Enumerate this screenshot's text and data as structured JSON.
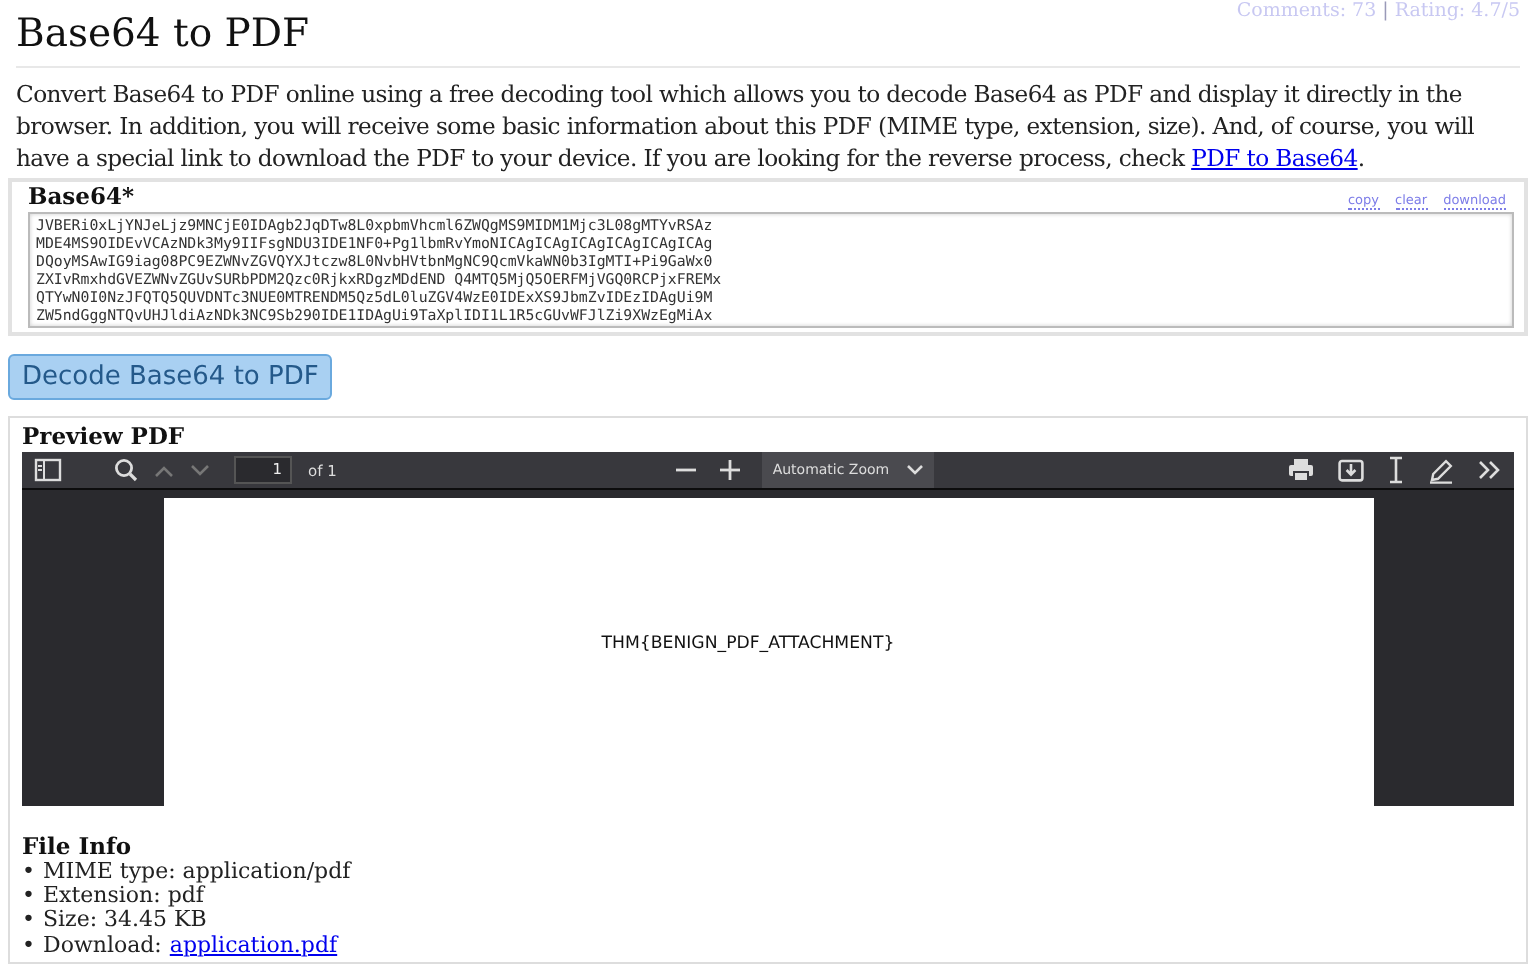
{
  "header": {
    "title": "Base64 to PDF",
    "comments": "Comments: 73",
    "separator": "|",
    "rating": "Rating: 4.7/5"
  },
  "intro": {
    "text": "Convert Base64 to PDF online using a free decoding tool which allows you to decode Base64 as PDF and display it directly in the browser. In addition, you will receive some basic information about this PDF (MIME type, extension, size). And, of course, you will have a special link to download the PDF to your device. If you are looking for the reverse process, check ",
    "link": "PDF to Base64",
    "end": "."
  },
  "input": {
    "label": "Base64*",
    "actions": [
      "copy",
      "clear",
      "download"
    ],
    "lines": [
      "JVBERi0xLjYNJeLjz9MNCjE0IDAgb2JqDTw8L0xpbmVhcml6ZWQgMS9MIDM1Mjc3L08gMTYvRSAz",
      "MDE4MS9OIDEvVCAzNDk3My9IIFsgNDU3IDE1NF0+Pg1lbmRvYmoNICAgICAgICAgICAgICAgICAg",
      "DQoyMSAwIG9iag08PC9EZWNvZGVQYXJtczw8L0NvbHVtbnMgNC9QcmVkaWN0b3IgMTI+Pi9GaWx0",
      "ZXIvRmxhdGVEZWNvZGUvSURbPDM2Qzc0RjkxRDgzMDdEND Q4MTQ5MjQ5OERFMjVGQ0RCPjxFREMx",
      "QTYwN0I0NzJFQTQ5QUVDNTc3NUE0MTRENDM5Qz5dL0luZGV4WzE0IDExXS9JbmZvIDEzIDAgUi9M",
      "ZW5ndGggNTQvUHJldiAzNDk3NC9Sb290IDE1IDAgUi9TaXplIDI1L1R5cGUvWFJlZi9XWzEgMiAx"
    ]
  },
  "decode_button": "Decode Base64 to PDF",
  "preview": {
    "title": "Preview PDF",
    "toolbar": {
      "page": "1",
      "page_count": "of 1",
      "zoom": "Automatic Zoom"
    },
    "page_text": "THM{BENIGN_PDF_ATTACHMENT}"
  },
  "file_info": {
    "title": "File Info",
    "items": [
      {
        "kind": "text",
        "bullet": "•",
        "label": "MIME type:",
        "value": "application/pdf"
      },
      {
        "kind": "text",
        "bullet": "•",
        "label": "Extension:",
        "value": "pdf"
      },
      {
        "kind": "text",
        "bullet": "•",
        "label": "Size:",
        "value": "34.45 KB"
      },
      {
        "kind": "link",
        "bullet": "•",
        "label": "Download:",
        "value": "application.pdf"
      }
    ]
  }
}
